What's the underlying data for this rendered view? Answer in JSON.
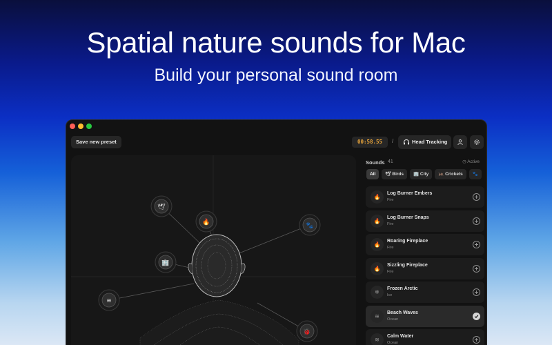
{
  "hero": {
    "title": "Spatial nature sounds for Mac",
    "subtitle": "Build your personal sound room"
  },
  "toolbar": {
    "save_preset": "Save new preset",
    "timer": "00:58.55",
    "separator": "/",
    "head_tracking": "Head Tracking"
  },
  "sidebar": {
    "sounds_label": "Sounds",
    "sounds_count": "41",
    "active_label": "Active",
    "filters": [
      {
        "label": "All",
        "icon": "none",
        "selected": true
      },
      {
        "label": "Birds",
        "icon": "bird-icon",
        "selected": false
      },
      {
        "label": "City",
        "icon": "building-icon",
        "selected": false
      },
      {
        "label": "Crickets",
        "icon": "cricket-icon",
        "selected": false
      },
      {
        "label": "",
        "icon": "paw-icon",
        "selected": false
      }
    ],
    "items": [
      {
        "name": "Log Burner Embers",
        "category": "Fire",
        "icon": "flame-icon",
        "active": false
      },
      {
        "name": "Log Burner Snaps",
        "category": "Fire",
        "icon": "flame-icon",
        "active": false
      },
      {
        "name": "Roaring Fireplace",
        "category": "Fire",
        "icon": "flame-icon",
        "active": false
      },
      {
        "name": "Sizzling Fireplace",
        "category": "Fire",
        "icon": "flame-icon",
        "active": false
      },
      {
        "name": "Frozen Arctic",
        "category": "Ice",
        "icon": "snowflake-icon",
        "active": false
      },
      {
        "name": "Beach Waves",
        "category": "Ocean",
        "icon": "waves-icon",
        "active": true
      },
      {
        "name": "Calm Water",
        "category": "Ocean",
        "icon": "waves-icon",
        "active": false
      }
    ]
  },
  "stage": {
    "nodes": [
      {
        "icon": "bird-icon"
      },
      {
        "icon": "flame-icon"
      },
      {
        "icon": "paw-icon"
      },
      {
        "icon": "building-icon"
      },
      {
        "icon": "waves-icon"
      },
      {
        "icon": "bug-icon"
      }
    ]
  },
  "colors": {
    "timer": "#e9a53a",
    "window_bg": "#121212",
    "panel_bg": "#171717"
  }
}
